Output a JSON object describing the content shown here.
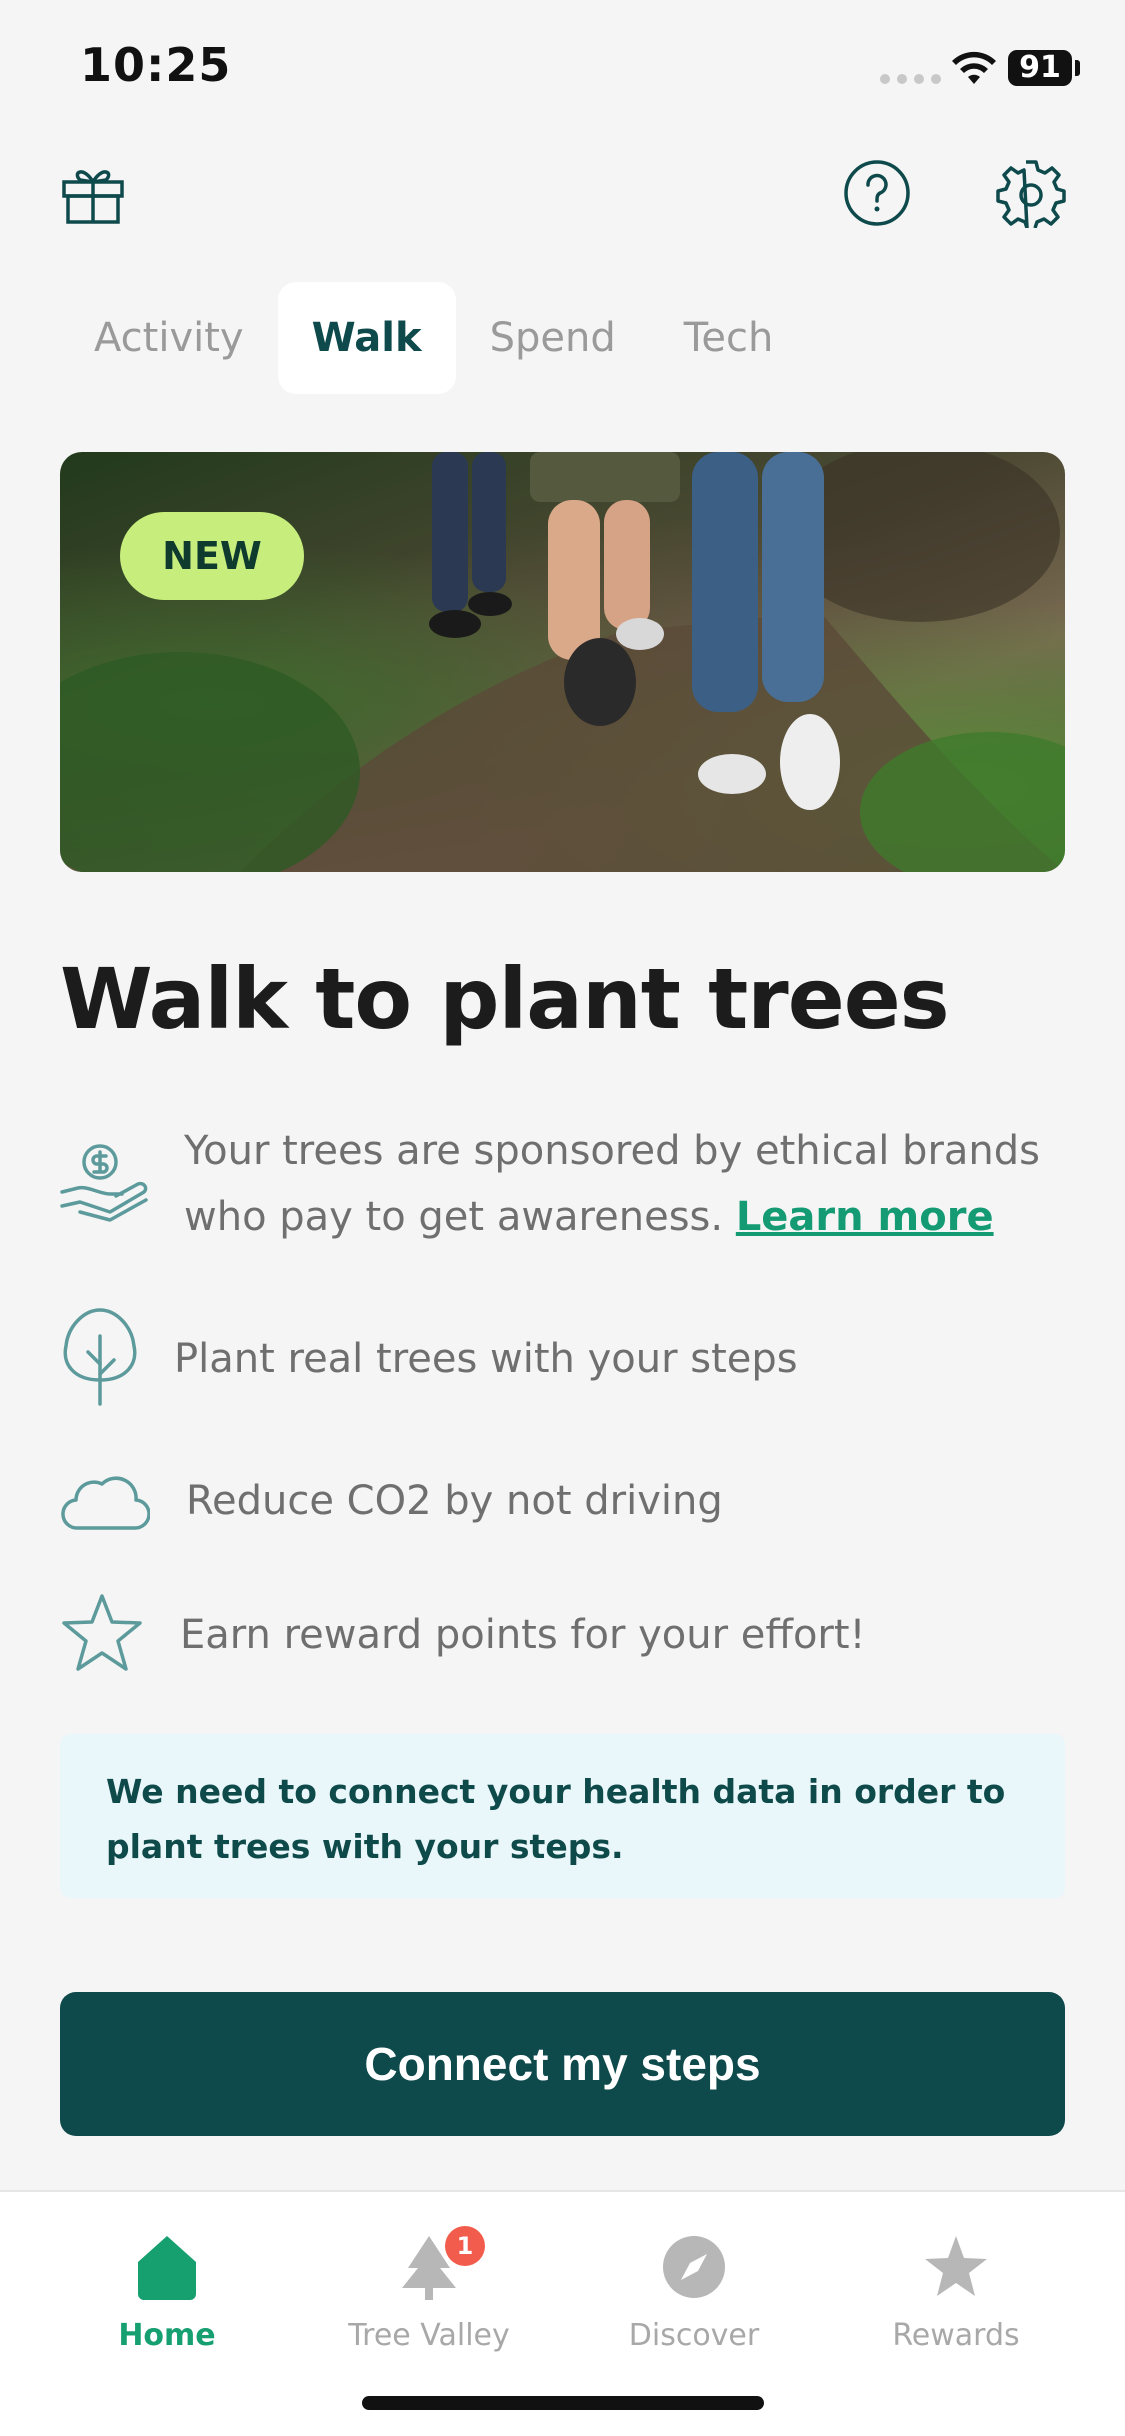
{
  "status_bar": {
    "time": "10:25",
    "battery": "91"
  },
  "tabs": [
    {
      "label": "Activity"
    },
    {
      "label": "Walk",
      "active": true
    },
    {
      "label": "Spend"
    },
    {
      "label": "Tech"
    }
  ],
  "hero": {
    "badge": "NEW"
  },
  "headline": "Walk to plant trees",
  "features": [
    {
      "icon": "hand-coin-icon",
      "text": "Your trees are sponsored by ethical brands who pay to get awareness.",
      "link": "Learn more"
    },
    {
      "icon": "tree-icon",
      "text": "Plant real trees with your steps"
    },
    {
      "icon": "cloud-icon",
      "text": "Reduce CO2 by not driving"
    },
    {
      "icon": "star-icon",
      "text": "Earn reward points for your effort!"
    }
  ],
  "info_box": "We need to connect your health data in order to plant trees with your steps.",
  "cta": "Connect my steps",
  "bottom_nav": [
    {
      "label": "Home",
      "icon": "home-icon",
      "active": true
    },
    {
      "label": "Tree Valley",
      "icon": "tree-valley-icon",
      "badge": "1"
    },
    {
      "label": "Discover",
      "icon": "compass-icon"
    },
    {
      "label": "Rewards",
      "icon": "star-icon"
    }
  ],
  "colors": {
    "primary": "#0e4a4c",
    "accent_green": "#159b73",
    "badge_lime": "#c7ee7c",
    "info_bg": "#e9f6fa",
    "icon_teal": "#5d9a9c",
    "notification": "#f25c4c"
  }
}
